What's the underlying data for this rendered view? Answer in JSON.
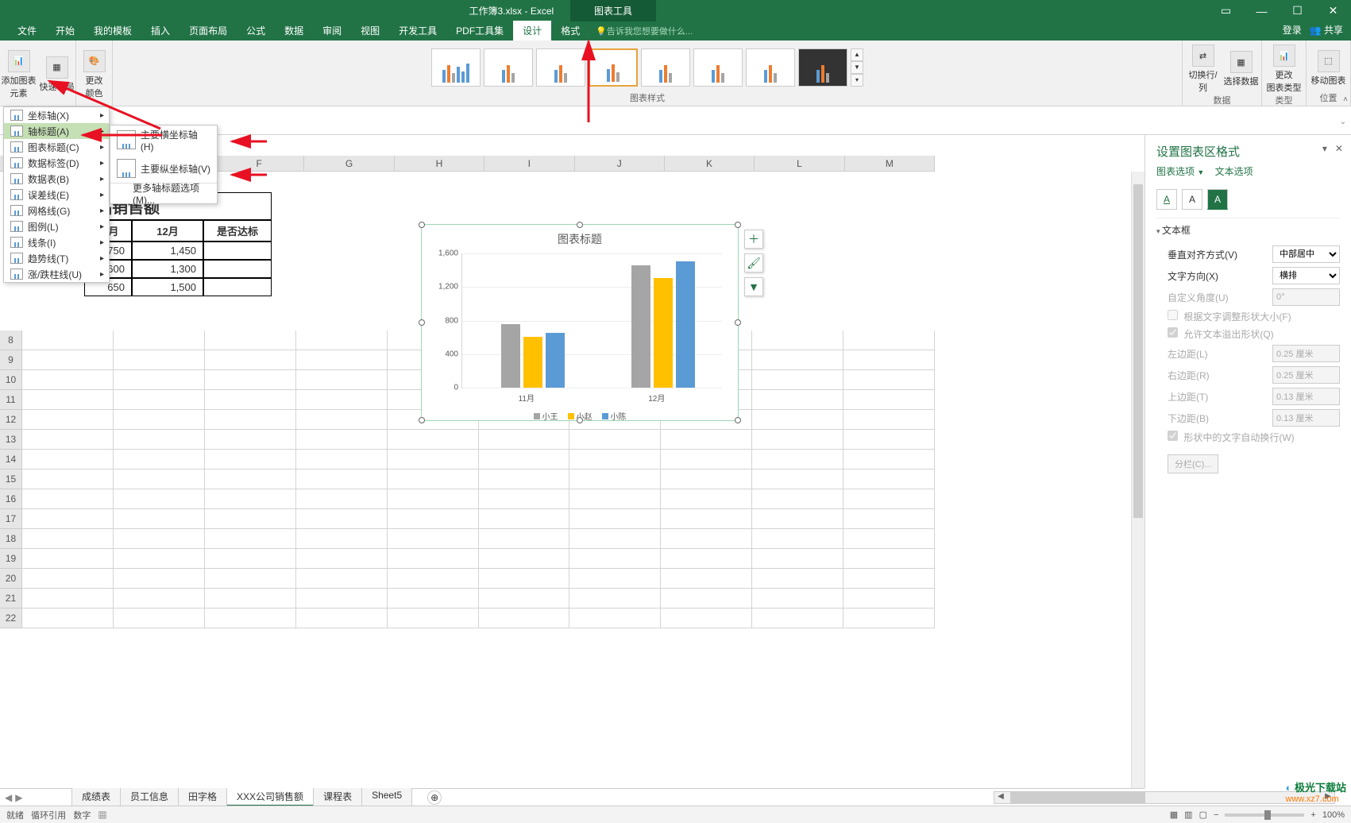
{
  "titlebar": {
    "filename": "工作簿3.xlsx - Excel",
    "chart_tools": "图表工具"
  },
  "ribbon": {
    "tabs": [
      "文件",
      "开始",
      "我的模板",
      "插入",
      "页面布局",
      "公式",
      "数据",
      "审阅",
      "视图",
      "开发工具",
      "PDF工具集",
      "设计",
      "格式"
    ],
    "active_tab": "设计",
    "tell_me": "告诉我您想要做什么...",
    "login": "登录",
    "share": "共享",
    "groups": {
      "add_element": "添加图表\n元素",
      "quick_layout": "快速布局",
      "change_colors": "更改\n颜色",
      "chart_styles": "图表样式",
      "switch_rc": "切换行/列",
      "select_data": "选择数据",
      "data": "数据",
      "change_type": "更改\n图表类型",
      "type": "类型",
      "move_chart": "移动图表",
      "location": "位置"
    }
  },
  "menu1": {
    "items": [
      {
        "label": "坐标轴(X)",
        "key": "axes"
      },
      {
        "label": "轴标题(A)",
        "key": "axis-titles",
        "highlighted": true
      },
      {
        "label": "图表标题(C)",
        "key": "chart-title"
      },
      {
        "label": "数据标签(D)",
        "key": "data-labels"
      },
      {
        "label": "数据表(B)",
        "key": "data-table"
      },
      {
        "label": "误差线(E)",
        "key": "error-bars"
      },
      {
        "label": "网格线(G)",
        "key": "gridlines"
      },
      {
        "label": "图例(L)",
        "key": "legend"
      },
      {
        "label": "线条(I)",
        "key": "lines"
      },
      {
        "label": "趋势线(T)",
        "key": "trendline"
      },
      {
        "label": "涨/跌柱线(U)",
        "key": "updown-bars"
      }
    ]
  },
  "menu2": {
    "items": [
      {
        "label": "主要横坐标轴(H)",
        "key": "primary-horizontal"
      },
      {
        "label": "主要纵坐标轴(V)",
        "key": "primary-vertical"
      }
    ],
    "more": "更多轴标题选项(M)..."
  },
  "columns": [
    "F",
    "G",
    "H",
    "I",
    "J",
    "K",
    "L",
    "M"
  ],
  "rows_visible": [
    8,
    9,
    10,
    11,
    12,
    13,
    14,
    15,
    16,
    17,
    18,
    19,
    20,
    21,
    22
  ],
  "table": {
    "title_fragment": "XXX公司产品销售额",
    "headers": [
      "11月",
      "12月",
      "是否达标"
    ],
    "rows": [
      {
        "nov": "750",
        "dec": "1,450",
        "reach": ""
      },
      {
        "nov": "600",
        "dec": "1,300",
        "reach": ""
      },
      {
        "nov": "650",
        "dec": "1,500",
        "reach": ""
      }
    ]
  },
  "chart_data": {
    "type": "bar",
    "title": "图表标题",
    "categories": [
      "11月",
      "12月"
    ],
    "series": [
      {
        "name": "小王",
        "color": "#a5a5a5",
        "values": [
          750,
          1450
        ]
      },
      {
        "name": "小赵",
        "color": "#ffc000",
        "values": [
          600,
          1300
        ]
      },
      {
        "name": "小陈",
        "color": "#5b9bd5",
        "values": [
          650,
          1500
        ]
      }
    ],
    "ylim": [
      0,
      1600
    ],
    "yticks": [
      0,
      400,
      800,
      1200,
      1600
    ],
    "xlabel": "",
    "ylabel": ""
  },
  "format_pane": {
    "title": "设置图表区格式",
    "chart_options": "图表选项",
    "text_options": "文本选项",
    "section": "文本框",
    "valign_label": "垂直对齐方式(V)",
    "valign_value": "中部居中",
    "text_dir_label": "文字方向(X)",
    "text_dir_value": "横排",
    "custom_angle_label": "自定义角度(U)",
    "custom_angle_value": "0°",
    "resize_shape": "根据文字调整形状大小(F)",
    "overflow": "允许文本溢出形状(Q)",
    "left_margin_label": "左边距(L)",
    "left_margin_value": "0.25 厘米",
    "right_margin_label": "右边距(R)",
    "right_margin_value": "0.25 厘米",
    "top_margin_label": "上边距(T)",
    "top_margin_value": "0.13 厘米",
    "bottom_margin_label": "下边距(B)",
    "bottom_margin_value": "0.13 厘米",
    "wrap": "形状中的文字自动换行(W)",
    "columns_btn": "分栏(C)..."
  },
  "sheet_tabs": [
    "成绩表",
    "员工信息",
    "田字格",
    "XXX公司销售额",
    "课程表",
    "Sheet5"
  ],
  "active_sheet": "XXX公司销售额",
  "status": {
    "ready": "就绪",
    "circ": "循环引用",
    "num": "数字",
    "zoom": "100%"
  },
  "watermark": {
    "brand": "极光下载站",
    "url": "www.xz7.com"
  }
}
